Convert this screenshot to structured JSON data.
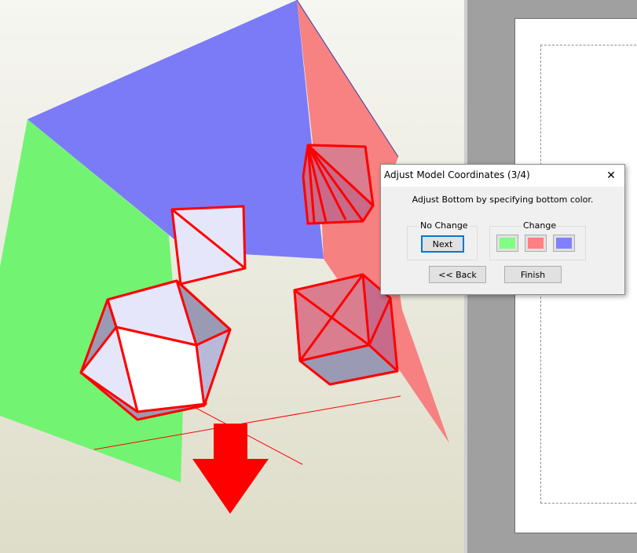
{
  "dialog": {
    "title": "Adjust Model Coordinates (3/4)",
    "close_glyph": "✕",
    "message": "Adjust Bottom by specifying bottom color.",
    "no_change": {
      "label": "No Change",
      "next_label": "Next"
    },
    "change": {
      "label": "Change",
      "colors": [
        "#80ff80",
        "#ff8080",
        "#8080ff"
      ]
    },
    "back_label": "<< Back",
    "finish_label": "Finish"
  },
  "scene": {
    "colors": {
      "background": "#ecebdf",
      "blue_plane": "#7b7bf7",
      "green_plane": "#72f472",
      "red_plane": "#f77b7b",
      "edge": "#ff0000",
      "face_light": "#e6e6fa",
      "face_shade": "#9a9ab4"
    },
    "icons": {
      "bottom_arrow": "red-down-arrow"
    }
  }
}
